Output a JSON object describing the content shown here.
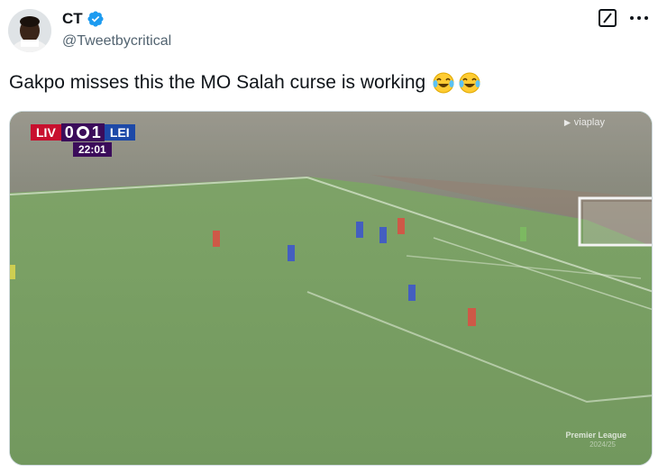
{
  "author": {
    "display_name": "CT",
    "handle": "@Tweetbycritical",
    "verified": true,
    "verified_color": "#1d9bf0"
  },
  "tweet": {
    "text": "Gakpo misses this the MO Salah curse is working",
    "emojis": [
      "face-with-tears-of-joy",
      "face-with-tears-of-joy"
    ]
  },
  "actions": {
    "grok_icon": "grok-slash-icon",
    "more_icon": "more-dots-icon"
  },
  "media": {
    "scorebug": {
      "home_team": "LIV",
      "home_score": "0",
      "away_score": "1",
      "away_team": "LEI",
      "clock": "22:01",
      "home_color": "#c8102e",
      "away_color": "#1d49a8",
      "bug_color": "#3b0c5a"
    },
    "broadcaster": "viaplay",
    "competition": "Premier League",
    "season": "2024/25"
  }
}
